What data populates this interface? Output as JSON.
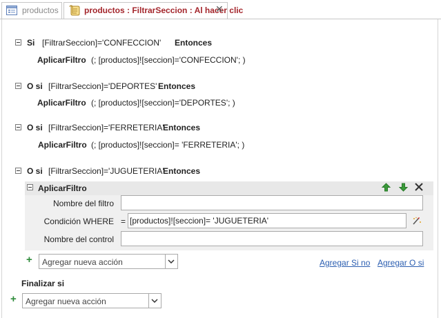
{
  "tabs": [
    {
      "label": "productos",
      "icon": "form-icon"
    },
    {
      "label": "productos : FiltrarSeccion : Al hacer clic",
      "icon": "macro-icon"
    }
  ],
  "blocks": [
    {
      "keyword": "Si",
      "condition": "[FiltrarSeccion]='CONFECCION'",
      "then": "Entonces",
      "action": "AplicarFiltro",
      "args": "(; [productos]![seccion]='CONFECCION'; )"
    },
    {
      "keyword": "O si",
      "condition": "[FiltrarSeccion]='DEPORTES'",
      "then": "Entonces",
      "action": "AplicarFiltro",
      "args": "(; [productos]![seccion]='DEPORTES'; )"
    },
    {
      "keyword": "O si",
      "condition": "[FiltrarSeccion]='FERRETERIA'",
      "then": "Entonces",
      "action": "AplicarFiltro",
      "args": "(; [productos]![seccion]= 'FERRETERIA'; )"
    },
    {
      "keyword": "O si",
      "condition": "[FiltrarSeccion]='JUGUETERIA'",
      "then": "Entonces"
    }
  ],
  "expanded_action": {
    "name": "AplicarFiltro",
    "fields": [
      {
        "label": "Nombre del filtro",
        "value": ""
      },
      {
        "label": "Condición WHERE",
        "prefix": "=",
        "value": "[productos]![seccion]= 'JUGUETERIA'"
      },
      {
        "label": "Nombre del control",
        "value": ""
      }
    ]
  },
  "inner_add_action": {
    "placeholder": "Agregar nueva acción"
  },
  "links": {
    "add_if_not": "Agregar Si no",
    "add_or_if": "Agregar O si"
  },
  "end_if": "Finalizar si",
  "outer_add_action": {
    "placeholder": "Agregar nueva acción"
  },
  "colors": {
    "tab_active_text": "#a4262c",
    "link": "#2a5db0",
    "arrow_green": "#2e8b3a"
  }
}
